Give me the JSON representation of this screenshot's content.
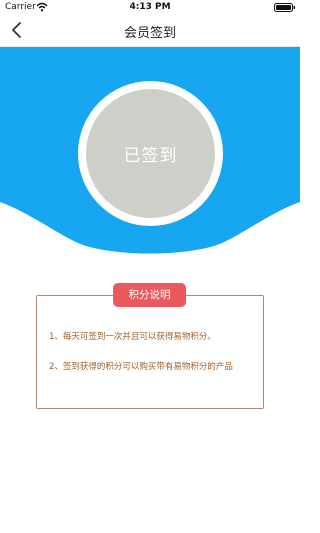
{
  "status_bar": {
    "carrier": "Carrier",
    "time": "4:13 PM"
  },
  "nav": {
    "title": "会员签到",
    "back_icon": "chevron-left-icon"
  },
  "sign_in": {
    "status_text": "已签到"
  },
  "points": {
    "badge_label": "积分说明",
    "rules": [
      "1、每天可签到一次并且可以获得易物积分。",
      "2、签到获得的积分可以购买带有易物积分的产品"
    ]
  },
  "colors": {
    "accent_blue": "#17a6f0",
    "badge_red": "#e85a5e",
    "rule_text": "#a0622f",
    "circle_gray": "#cfcfca"
  }
}
